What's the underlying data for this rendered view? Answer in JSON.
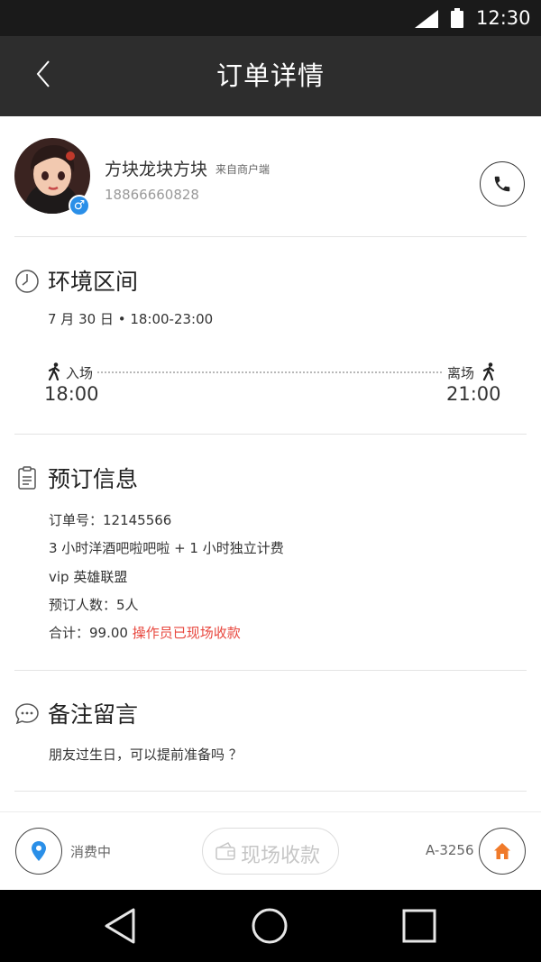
{
  "status_bar": {
    "time": "12:30",
    "icons": [
      "signal-icon",
      "battery-icon"
    ]
  },
  "header": {
    "title": "订单详情",
    "back_icon": "chevron-left-icon"
  },
  "user": {
    "name": "方块龙块方块",
    "source": "来自商户端",
    "phone": "18866660828",
    "gender_symbol": "♂",
    "call_icon": "phone-icon"
  },
  "time_section": {
    "title": "环境区间",
    "icon": "clock-icon",
    "date": "7 月 30 日 • 18:00-23:00",
    "entry_label": "入场",
    "entry_time": "18:00",
    "exit_label": "离场",
    "exit_time": "21:00"
  },
  "booking": {
    "title": "预订信息",
    "icon": "clipboard-icon",
    "order_no": "订单号：12145566",
    "package": "3 小时洋酒吧啦吧啦 + 1 小时独立计费",
    "room": "vip 英雄联盟",
    "guests": "预订人数：5人",
    "total": "合计：99.00",
    "payment_status": "操作员已现场收款"
  },
  "note": {
    "title": "备注留言",
    "icon": "chat-bubble-icon",
    "text": "朋友过生日，可以提前准备吗 ？"
  },
  "bottom_bar": {
    "state": "消费中",
    "collect_label": "现场收款",
    "room_code": "A-3256",
    "location_icon": "location-pin-icon",
    "home_icon": "home-icon"
  },
  "colors": {
    "header_bg": "#2d2d2d",
    "status_bg": "#1a1a1a",
    "accent_blue": "#2a8fe8",
    "accent_orange": "#f07a2a",
    "alert_red": "#e8473e"
  }
}
